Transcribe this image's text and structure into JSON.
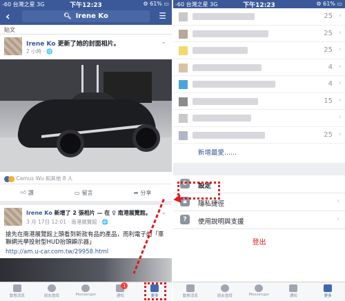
{
  "left": {
    "status": {
      "carrier": "-60 台灣之星  3G",
      "time": "下午12:23",
      "battery": "⚙ 61% ▭"
    },
    "search": {
      "query": "Irene Ko"
    },
    "section_label": "貼文",
    "post1": {
      "author": "Irene Ko",
      "action": " 更新了她的封面相片。",
      "time": "2 小時 · 🌐",
      "reactions": "Camus Wu 和其他 8 人",
      "like_label": "讚",
      "comment_label": "留言",
      "share_label": "分享"
    },
    "post2": {
      "author": "Irene Ko",
      "action": " 新增了 2 張相片 — 在 ♀ 南港展覽館。",
      "time": "3 月 17日 12:01 · 南港展覽館 · 🌐",
      "text": "搶先在南港展覽館上頭看到新款有品的產品，而利電子的「車聯網光學投射型HUD抬頭顯示器」",
      "link": "http://am.u-car.com.tw/29958.html"
    },
    "tabs": [
      {
        "label": "動態消息",
        "icon": "news-feed-icon"
      },
      {
        "label": "朋友邀請",
        "icon": "friends-icon"
      },
      {
        "label": "Messenger",
        "icon": "messenger-icon"
      },
      {
        "label": "通知",
        "icon": "notifications-icon",
        "badge": "1"
      },
      {
        "label": "更多",
        "icon": "menu-icon"
      }
    ]
  },
  "right": {
    "status": {
      "carrier": "-60 台灣之星  3G",
      "time": "下午12:23",
      "battery": "⚙ 61% ▭"
    },
    "shortcuts": [
      {
        "count": "25",
        "color": "#c7c7cc"
      },
      {
        "count": "25",
        "color": "#b8a89a"
      },
      {
        "count": "25",
        "color": "#f5d76e"
      },
      {
        "count": "4",
        "color": "#d9c3a7"
      },
      {
        "count": "4",
        "color": "#4aa3df"
      },
      {
        "count": "15",
        "color": "#8b8b8b"
      },
      {
        "count": "",
        "color": "#c9c9c9"
      },
      {
        "count": "25",
        "color": "#b0b6c3"
      }
    ],
    "see_more": "新增最愛......",
    "settings": "設定",
    "privacy": "隱私捷徑",
    "help": "使用說明與支援",
    "logout": "登出",
    "tabs": [
      {
        "label": "動態消息",
        "icon": "news-feed-icon"
      },
      {
        "label": "朋友邀請",
        "icon": "friends-icon"
      },
      {
        "label": "Messenger",
        "icon": "messenger-icon"
      },
      {
        "label": "通知",
        "icon": "notifications-icon"
      },
      {
        "label": "更多",
        "icon": "menu-icon"
      }
    ]
  }
}
